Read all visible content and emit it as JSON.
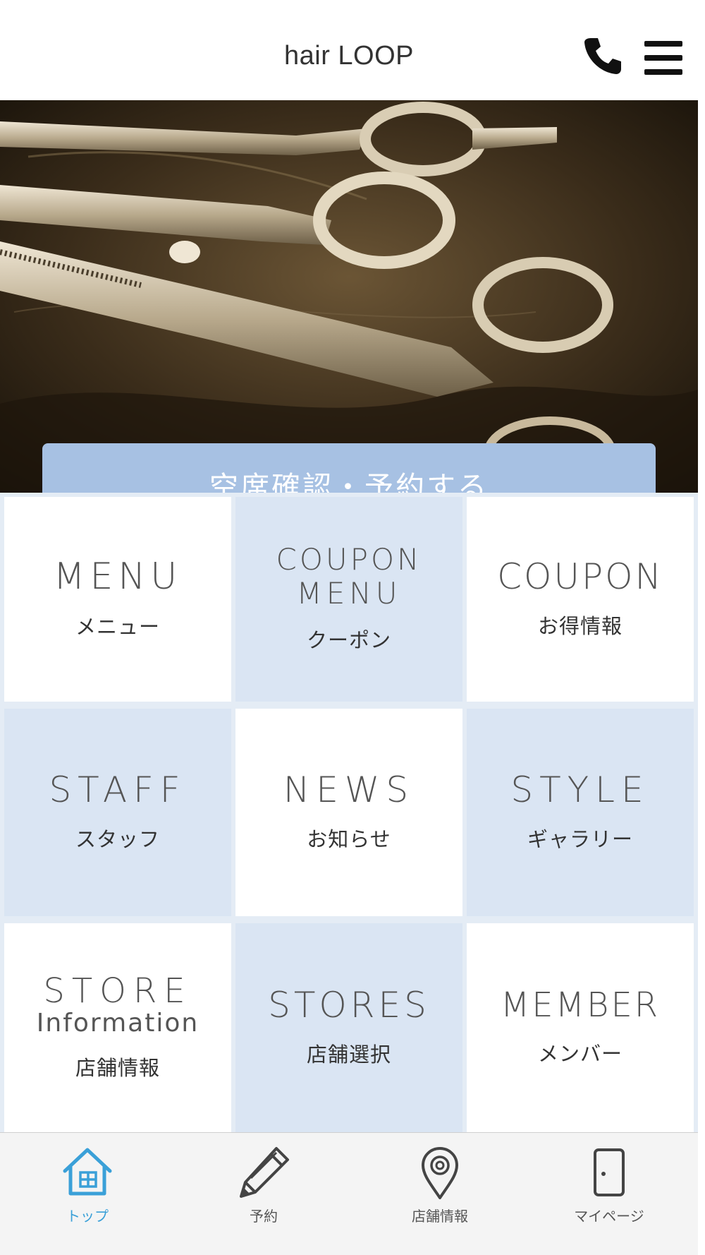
{
  "header": {
    "title": "hair LOOP"
  },
  "hero": {
    "reserve_label": "空席確認・予約する"
  },
  "tiles": [
    {
      "en": "MENU",
      "en_sub": "",
      "ja": "メニュー"
    },
    {
      "en": "COUPON",
      "en_sub": "MENU",
      "ja": "クーポン"
    },
    {
      "en": "COUPON",
      "en_sub": "",
      "ja": "お得情報"
    },
    {
      "en": "STAFF",
      "en_sub": "",
      "ja": "スタッフ"
    },
    {
      "en": "NEWS",
      "en_sub": "",
      "ja": "お知らせ"
    },
    {
      "en": "STYLE",
      "en_sub": "",
      "ja": "ギャラリー"
    },
    {
      "en": "STORE",
      "en_sub": "Information",
      "ja": "店舗情報"
    },
    {
      "en": "STORES",
      "en_sub": "",
      "ja": "店舗選択"
    },
    {
      "en": "MEMBER",
      "en_sub": "",
      "ja": "メンバー"
    }
  ],
  "tabbar": {
    "items": [
      {
        "label": "トップ",
        "icon": "home-icon",
        "active": true
      },
      {
        "label": "予約",
        "icon": "pencil-icon",
        "active": false
      },
      {
        "label": "店舗情報",
        "icon": "map-pin-icon",
        "active": false
      },
      {
        "label": "マイページ",
        "icon": "door-icon",
        "active": false
      }
    ]
  },
  "colors": {
    "accent": "#a7c1e3",
    "tile_blue": "#dae5f3",
    "active_tab": "#3aa0d8"
  }
}
